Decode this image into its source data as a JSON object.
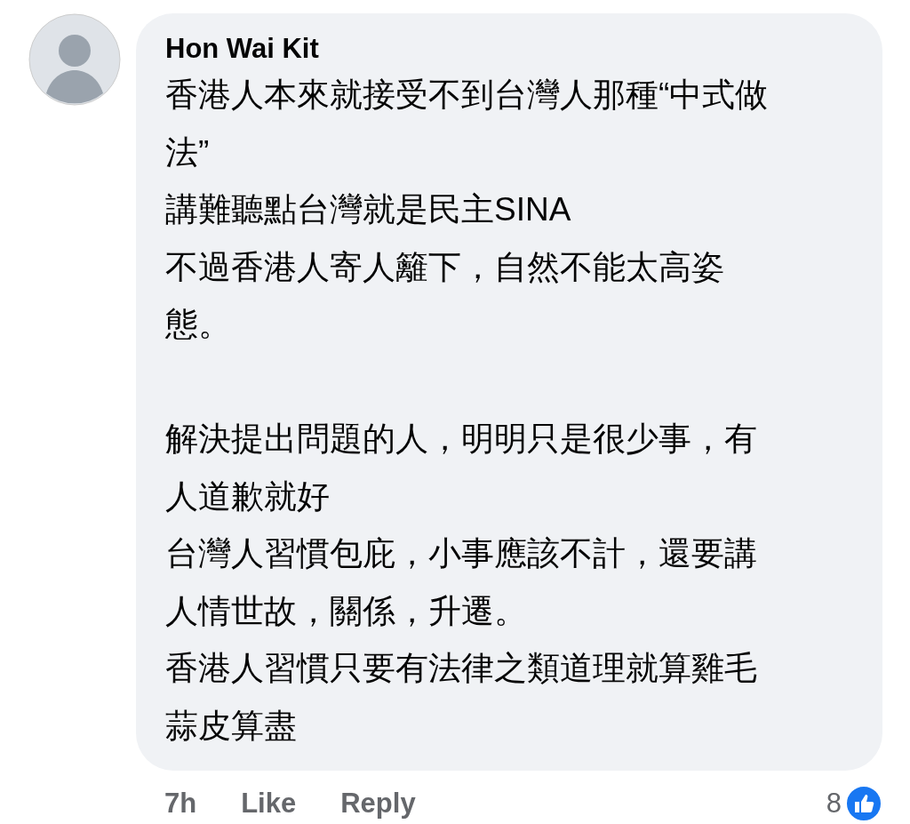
{
  "comment": {
    "author": "Hon Wai Kit",
    "paragraphs": [
      [
        "香港人本來就接受不到台灣人那種“中式做",
        "法”",
        "講難聽點台灣就是民主SINA",
        "不過香港人寄人籬下，自然不能太高姿",
        "態。"
      ],
      [
        "解決提出問題的人，明明只是很少事，有",
        "人道歉就好",
        "台灣人習慣包庇，小事應該不計，還要講",
        "人情世故，關係，升遷。",
        "香港人習慣只要有法律之類道理就算雞毛",
        "蒜皮算盡"
      ]
    ],
    "time": "7h",
    "actions": [
      "Like",
      "Reply"
    ],
    "reaction_count": "8"
  }
}
